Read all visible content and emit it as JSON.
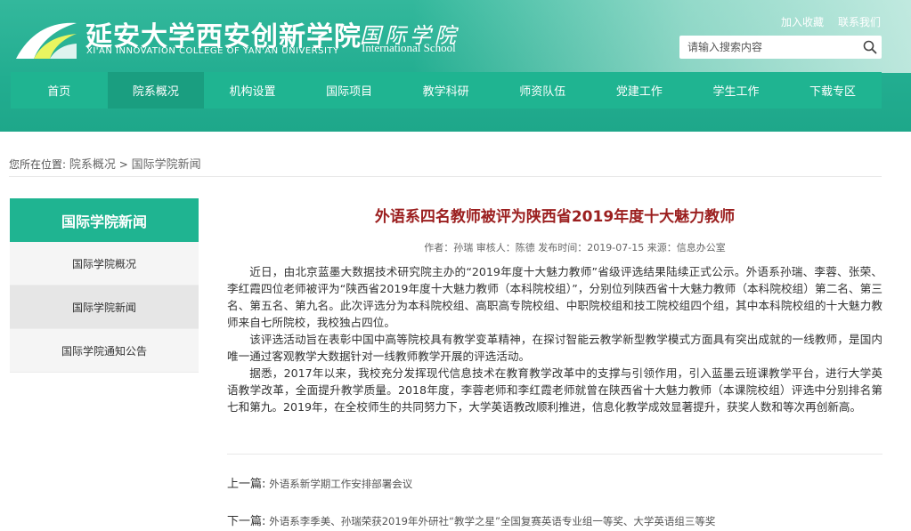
{
  "header": {
    "school_name_cn": "延安大学西安创新学院",
    "school_name_en": "XI'AN INNOVATION COLLEGE OF YAN'AN UNIVERSITY",
    "intl_cn": "国际学院",
    "intl_en": "International School",
    "top_links": [
      "加入收藏",
      "联系我们"
    ],
    "search_placeholder": "请输入搜索内容"
  },
  "nav": {
    "items": [
      "首页",
      "院系概况",
      "机构设置",
      "国际项目",
      "教学科研",
      "师资队伍",
      "党建工作",
      "学生工作",
      "下载专区"
    ],
    "active_index": 1
  },
  "breadcrumb": {
    "prefix": "您所在位置:",
    "path1": "院系概况",
    "sep": ">",
    "path2": "国际学院新闻"
  },
  "sidebar": {
    "title": "国际学院新闻",
    "items": [
      "国际学院概况",
      "国际学院新闻",
      "国际学院通知公告"
    ],
    "active_index": 1
  },
  "article": {
    "title": "外语系四名教师被评为陕西省2019年度十大魅力教师",
    "meta": "作者：孙瑞  审核人：陈德  发布时间：2019-07-15  来源：信息办公室",
    "paragraphs": [
      "近日，由北京蓝墨大数据技术研究院主办的“2019年度十大魅力教师”省级评选结果陆续正式公示。外语系孙瑞、李蓉、张荣、李红霞四位老师被评为“陕西省2019年度十大魅力教师（本科院校组）”，分别位列陕西省十大魅力教师（本科院校组）第二名、第三名、第五名、第九名。此次评选分为本科院校组、高职高专院校组、中职院校组和技工院校组四个组，其中本科院校组的十大魅力教师来自七所院校，我校独占四位。",
      "该评选活动旨在表彰中国中高等院校具有教学变革精神，在探讨智能云教学新型教学模式方面具有突出成就的一线教师，是国内唯一通过客观教学大数据针对一线教师教学开展的评选活动。",
      "据悉，2017年以来，我校充分发挥现代信息技术在教育教学改革中的支撑与引领作用，引入蓝墨云班课教学平台，进行大学英语教学改革，全面提升教学质量。2018年度，李蓉老师和李红霞老师就曾在陕西省十大魅力教师（本课院校组）评选中分别排名第七和第九。2019年，在全校师生的共同努力下，大学英语教改顺利推进，信息化教学成效显著提升，获奖人数和等次再创新高。"
    ],
    "prev_label": "上一篇:",
    "prev_title": "外语系新学期工作安排部署会议",
    "next_label": "下一篇:",
    "next_title": "外语系李季美、孙瑞荣获2019年外研社“教学之星”全国复赛英语专业组一等奖、大学英语组三等奖"
  },
  "colors": {
    "header_green": "#22ad90",
    "nav_green": "#1fb491",
    "nav_active": "#1a9e80",
    "title_red": "#9b1f1f"
  }
}
